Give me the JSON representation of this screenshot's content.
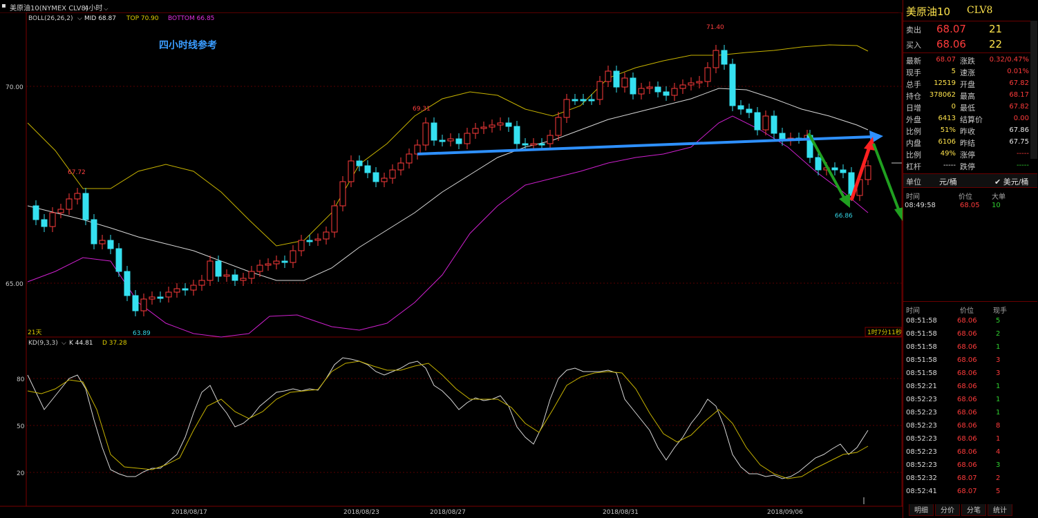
{
  "header": {
    "symbol": "美原油10(NYMEX CLV8)",
    "period": "4小时",
    "period_arrow": "chevron-down"
  },
  "main_chart": {
    "indicator_name": "BOLL(26,26,2)",
    "mid_label": "MID 68.87",
    "top_label": "TOP 70.90",
    "bottom_label": "BOTTOM 66.85",
    "annotation": "四小时线参考",
    "y_labels": [
      "70.00",
      "65.00"
    ],
    "price_marks": [
      "71.40",
      "69.31",
      "67.72",
      "63.89",
      "66.86"
    ],
    "bottom_left": "21天",
    "countdown": "1时7分11秒"
  },
  "sub_chart": {
    "indicator_name": "KD(9,3,3)",
    "k_label": "K 44.81",
    "d_label": "D 37.28",
    "y_labels": [
      "80",
      "50",
      "20"
    ]
  },
  "x_axis": [
    "2018/08/17",
    "2018/08/23",
    "2018/08/27",
    "2018/08/31",
    "2018/09/06"
  ],
  "quote": {
    "title": "美原油10",
    "code": "CLV8",
    "sell_label": "卖出",
    "sell_price": "68.07",
    "sell_qty": "21",
    "buy_label": "买入",
    "buy_price": "68.06",
    "buy_qty": "22",
    "stats": [
      {
        "l1": "最新",
        "v1": "68.07",
        "c1": "red",
        "l2": "涨跌",
        "v2": "0.32/0.47%",
        "c2": "red"
      },
      {
        "l1": "现手",
        "v1": "5",
        "c1": "yel",
        "l2": "速涨",
        "v2": "0.01%",
        "c2": "red"
      },
      {
        "l1": "总手",
        "v1": "12519",
        "c1": "yel",
        "l2": "开盘",
        "v2": "67.82",
        "c2": "red"
      },
      {
        "l1": "持仓",
        "v1": "378062",
        "c1": "yel",
        "l2": "最高",
        "v2": "68.17",
        "c2": "red"
      },
      {
        "l1": "日增",
        "v1": "0",
        "c1": "yel",
        "l2": "最低",
        "v2": "67.82",
        "c2": "red"
      },
      {
        "l1": "外盘",
        "v1": "6413",
        "c1": "yel",
        "l2": "结算价",
        "v2": "0.00",
        "c2": "red"
      },
      {
        "l1": "比例",
        "v1": "51%",
        "c1": "yel",
        "l2": "昨收",
        "v2": "67.86",
        "c2": "wht"
      },
      {
        "l1": "内盘",
        "v1": "6106",
        "c1": "yel",
        "l2": "昨结",
        "v2": "67.75",
        "c2": "wht"
      },
      {
        "l1": "比例",
        "v1": "49%",
        "c1": "yel",
        "l2": "涨停",
        "v2": "-----",
        "c2": "red"
      },
      {
        "l1": "杠杆",
        "v1": "-----",
        "c1": "wht",
        "l2": "跌停",
        "v2": "-----",
        "c2": "grn"
      }
    ],
    "unit_label": "单位",
    "unit_value": "元/桶",
    "unit_option": "✔ 美元/桶",
    "big_header": {
      "time": "时间",
      "price": "价位",
      "big": "大单"
    },
    "big_orders": [
      {
        "time": "08:49:58",
        "price": "68.05",
        "qty": "10"
      }
    ],
    "tick_header": {
      "time": "时间",
      "price": "价位",
      "qty": "现手"
    },
    "ticks": [
      {
        "time": "08:51:58",
        "price": "68.06",
        "qty": "5",
        "c": "grn"
      },
      {
        "time": "08:51:58",
        "price": "68.06",
        "qty": "2",
        "c": "grn"
      },
      {
        "time": "08:51:58",
        "price": "68.06",
        "qty": "1",
        "c": "grn"
      },
      {
        "time": "08:51:58",
        "price": "68.06",
        "qty": "3",
        "c": "red"
      },
      {
        "time": "08:51:58",
        "price": "68.06",
        "qty": "3",
        "c": "red"
      },
      {
        "time": "08:52:21",
        "price": "68.06",
        "qty": "1",
        "c": "grn"
      },
      {
        "time": "08:52:23",
        "price": "68.06",
        "qty": "1",
        "c": "grn"
      },
      {
        "time": "08:52:23",
        "price": "68.06",
        "qty": "1",
        "c": "grn"
      },
      {
        "time": "08:52:23",
        "price": "68.06",
        "qty": "8",
        "c": "red"
      },
      {
        "time": "08:52:23",
        "price": "68.06",
        "qty": "1",
        "c": "red"
      },
      {
        "time": "08:52:23",
        "price": "68.06",
        "qty": "4",
        "c": "red"
      },
      {
        "time": "08:52:23",
        "price": "68.06",
        "qty": "3",
        "c": "grn"
      },
      {
        "time": "08:52:32",
        "price": "68.07",
        "qty": "2",
        "c": "red"
      },
      {
        "time": "08:52:41",
        "price": "68.07",
        "qty": "5",
        "c": "red"
      }
    ],
    "tabs": [
      "明细",
      "分价",
      "分笔",
      "统计"
    ]
  },
  "colors": {
    "bg": "#000000",
    "up": "#ff3b3b",
    "down": "#35e0f0",
    "mid_line": "#d8d8d8",
    "top_line": "#c8b400",
    "bottom_line": "#d020d0",
    "trend_arrow": "#2e90ff",
    "green_arrow": "#20a020",
    "red_arrow": "#ff2020"
  }
}
